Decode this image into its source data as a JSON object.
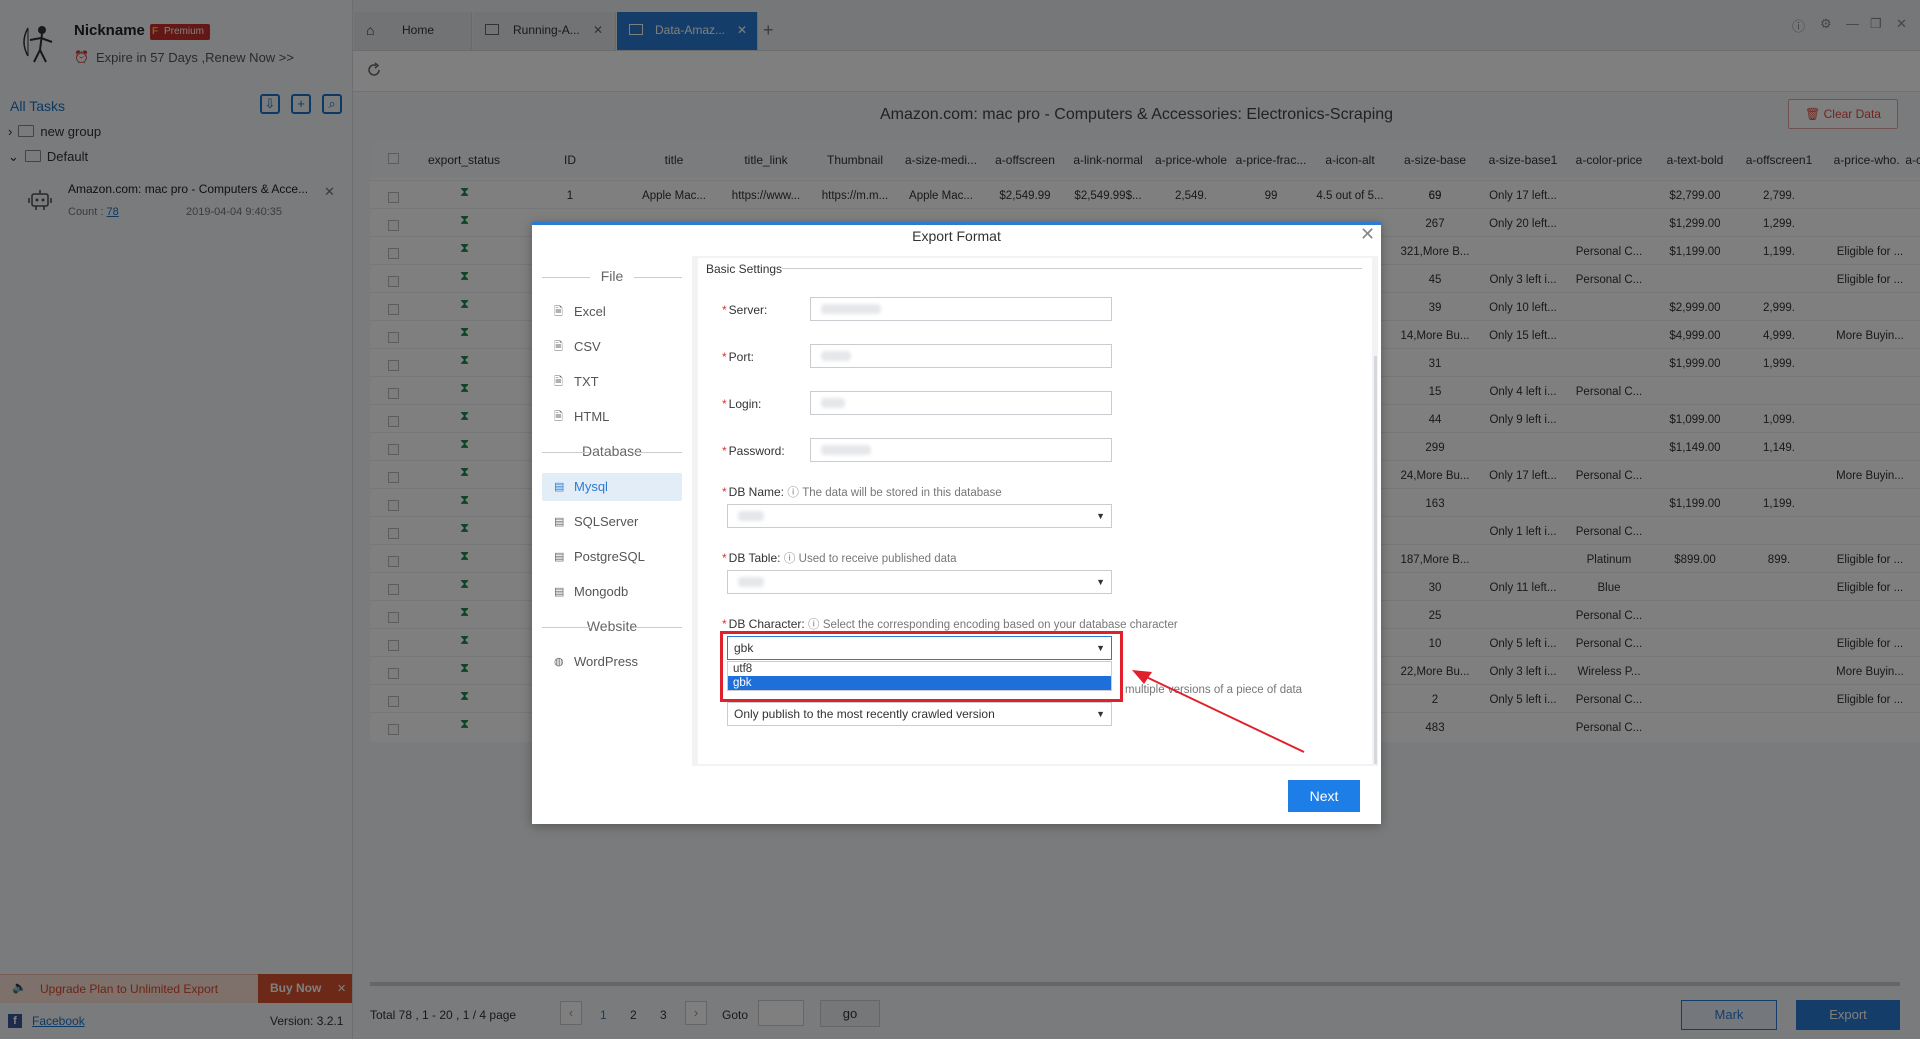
{
  "user": {
    "nickname": "Nickname",
    "plan_letter": "F",
    "plan": "Premium",
    "expire": "Expire in 57 Days ,Renew Now >>"
  },
  "sidebar": {
    "all_tasks": "All Tasks",
    "groups": [
      {
        "label": "new group"
      },
      {
        "label": "Default"
      }
    ],
    "task": {
      "title": "Amazon.com: mac pro - Computers & Acce...",
      "count_label": "Count :",
      "count": "78",
      "date": "2019-04-04 9:40:35"
    },
    "upgrade": "Upgrade Plan to Unlimited Export",
    "buy_now": "Buy Now",
    "facebook": "Facebook",
    "version": "Version: 3.2.1"
  },
  "tabs": [
    {
      "label": "Home"
    },
    {
      "label": "Running-A..."
    },
    {
      "label": "Data-Amaz..."
    }
  ],
  "page": {
    "title": "Amazon.com: mac pro - Computers & Accessories: Electronics-Scraping",
    "clear": "Clear Data"
  },
  "table": {
    "columns": [
      "export_status",
      "ID",
      "title",
      "title_link",
      "Thumbnail",
      "a-size-medi...",
      "a-offscreen",
      "a-link-normal",
      "a-price-whole",
      "a-price-frac...",
      "a-icon-alt",
      "a-size-base",
      "a-size-base1",
      "a-color-price",
      "a-text-bold",
      "a-offscreen1",
      "a-price-who...",
      "a-color-sec..."
    ],
    "first_row": [
      "1",
      "Apple Mac...",
      "https://www...",
      "https://m.m...",
      "Apple Mac...",
      "$2,549.99",
      "$2,549.99$...",
      "2,549.",
      "99",
      "4.5 out of 5...",
      "69"
    ],
    "right_rows": [
      [
        "69",
        "Only 17 left...",
        "",
        "$2,799.00",
        "2,799.",
        ""
      ],
      [
        "267",
        "Only 20 left...",
        "",
        "$1,299.00",
        "1,299.",
        ""
      ],
      [
        "321,More B...",
        "",
        "Personal C...",
        "$1,199.00",
        "1,199.",
        "Eligible for ..."
      ],
      [
        "45",
        "Only 3 left i...",
        "Personal C...",
        "",
        "",
        "Eligible for ..."
      ],
      [
        "39",
        "Only 10 left...",
        "",
        "$2,999.00",
        "2,999.",
        ""
      ],
      [
        "14,More Bu...",
        "Only 15 left...",
        "",
        "$4,999.00",
        "4,999.",
        "More Buyin..."
      ],
      [
        "31",
        "",
        "",
        "$1,999.00",
        "1,999.",
        ""
      ],
      [
        "15",
        "Only 4 left i...",
        "Personal C...",
        "",
        "",
        ""
      ],
      [
        "44",
        "Only 9 left i...",
        "",
        "$1,099.00",
        "1,099.",
        ""
      ],
      [
        "299",
        "",
        "",
        "$1,149.00",
        "1,149.",
        ""
      ],
      [
        "24,More Bu...",
        "Only 17 left...",
        "Personal C...",
        "",
        "",
        "More Buyin..."
      ],
      [
        "163",
        "",
        "",
        "$1,199.00",
        "1,199.",
        ""
      ],
      [
        "",
        "Only 1 left i...",
        "Personal C...",
        "",
        "",
        ""
      ],
      [
        "187,More B...",
        "",
        "Platinum",
        "$899.00",
        "899.",
        "Eligible for ..."
      ],
      [
        "30",
        "Only 11 left...",
        "Blue",
        "",
        "",
        "Eligible for ..."
      ],
      [
        "25",
        "",
        "Personal C...",
        "",
        "",
        ""
      ],
      [
        "10",
        "Only 5 left i...",
        "Personal C...",
        "",
        "",
        "Eligible for ..."
      ],
      [
        "22,More Bu...",
        "Only 3 left i...",
        "Wireless P...",
        "",
        "",
        "More Buyin..."
      ],
      [
        "2",
        "Only 5 left i...",
        "Personal C...",
        "",
        "",
        "Eligible for ..."
      ],
      [
        "483",
        "",
        "Personal C...",
        "",
        "",
        ""
      ]
    ]
  },
  "pagination": {
    "total": "Total  78  ,  1 - 20 ,  1  /  4  page",
    "pages": [
      "1",
      "2",
      "3"
    ],
    "goto": "Goto",
    "go": "go",
    "mark": "Mark",
    "export": "Export"
  },
  "modal": {
    "title": "Export Format",
    "nav": {
      "file_section": "File",
      "file_items": [
        "Excel",
        "CSV",
        "TXT",
        "HTML"
      ],
      "db_section": "Database",
      "db_items": [
        "Mysql",
        "SQLServer",
        "PostgreSQL",
        "Mongodb"
      ],
      "web_section": "Website",
      "web_items": [
        "WordPress"
      ]
    },
    "basic_settings": "Basic Settings",
    "server_label": "Server:",
    "port_label": "Port:",
    "login_label": "Login:",
    "password_label": "Password:",
    "dbname_label": "DB Name:",
    "dbname_hint": "The data will be stored in this database",
    "dbtable_label": "DB Table:",
    "dbtable_hint": "Used to receive published data",
    "dbchar_label": "DB Character:",
    "dbchar_hint": "Select the corresponding encoding based on your database character",
    "dbchar_value": "gbk",
    "dbchar_options": [
      "utf8",
      "gbk"
    ],
    "versions_hint": "multiple versions of a piece of data",
    "publish_value": "Only publish to the most recently crawled version",
    "next": "Next"
  },
  "colors": {
    "accent": "#2b7bd2",
    "highlight_box": "#e0202a",
    "danger": "#d9532f"
  }
}
